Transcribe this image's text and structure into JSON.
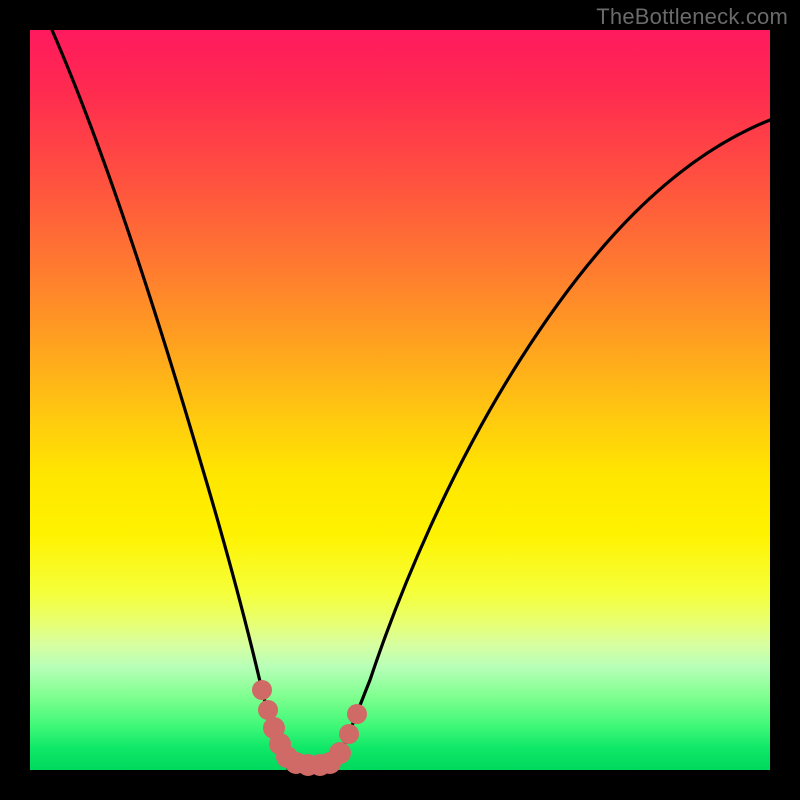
{
  "watermark": "TheBottleneck.com",
  "chart_data": {
    "type": "line",
    "title": "",
    "xlabel": "",
    "ylabel": "",
    "xlim": [
      0,
      100
    ],
    "ylim": [
      0,
      100
    ],
    "grid": false,
    "series": [
      {
        "name": "bottleneck-curve",
        "x": [
          3,
          10,
          15,
          20,
          25,
          28,
          30,
          32,
          34,
          36,
          38,
          40,
          44,
          50,
          56,
          62,
          70,
          78,
          86,
          94,
          100
        ],
        "values": [
          100,
          80,
          66,
          52,
          36,
          24,
          14,
          6,
          2,
          0,
          0,
          2,
          8,
          20,
          32,
          44,
          56,
          66,
          74,
          80,
          84
        ]
      }
    ],
    "annotations": [
      {
        "name": "valley-dot-cluster",
        "x_range": [
          28,
          42
        ],
        "y_range": [
          0,
          14
        ],
        "color": "#cf6a66"
      }
    ],
    "colors": {
      "curve": "#000000",
      "dots": "#cf6a66",
      "gradient_top": "#ff1a5e",
      "gradient_bottom": "#00d85e"
    }
  }
}
